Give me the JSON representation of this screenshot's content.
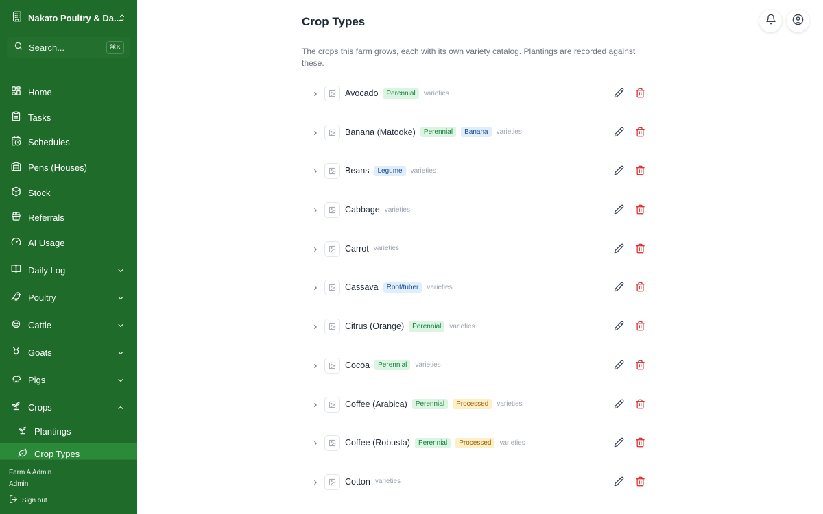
{
  "farm": {
    "name": "Nakato Poultry & Da..."
  },
  "search": {
    "placeholder": "Search...",
    "shortcut": "⌘K"
  },
  "nav": [
    {
      "label": "Home",
      "icon": "grid-icon"
    },
    {
      "label": "Tasks",
      "icon": "clipboard-icon"
    },
    {
      "label": "Schedules",
      "icon": "calendar-clock-icon"
    },
    {
      "label": "Pens (Houses)",
      "icon": "warehouse-icon"
    },
    {
      "label": "Stock",
      "icon": "box-icon"
    },
    {
      "label": "Referrals",
      "icon": "gift-icon"
    },
    {
      "label": "AI Usage",
      "icon": "gauge-icon"
    },
    {
      "label": "Daily Log",
      "icon": "book-icon",
      "expanded": false
    },
    {
      "label": "Poultry",
      "icon": "bird-icon",
      "expanded": false
    },
    {
      "label": "Cattle",
      "icon": "cow-icon",
      "expanded": false
    },
    {
      "label": "Goats",
      "icon": "goat-icon",
      "expanded": false
    },
    {
      "label": "Pigs",
      "icon": "pig-icon",
      "expanded": false
    },
    {
      "label": "Crops",
      "icon": "sprout-icon",
      "expanded": true
    }
  ],
  "subnav": [
    {
      "label": "Plantings",
      "icon": "sprout-icon"
    },
    {
      "label": "Crop Types",
      "icon": "leaf-icon",
      "active": true
    }
  ],
  "user": {
    "name": "Farm A Admin",
    "role": "Admin",
    "signout": "Sign out"
  },
  "page": {
    "title": "Crop Types",
    "description": "The crops this farm grows, each with its own variety catalog. Plantings are recorded against these."
  },
  "varieties_label": "varieties",
  "crops": [
    {
      "name": "Avocado",
      "tags": [
        {
          "text": "Perennial",
          "color": "green"
        }
      ]
    },
    {
      "name": "Banana (Matooke)",
      "tags": [
        {
          "text": "Perennial",
          "color": "green"
        },
        {
          "text": "Banana",
          "color": "blue"
        }
      ]
    },
    {
      "name": "Beans",
      "tags": [
        {
          "text": "Legume",
          "color": "blue"
        }
      ]
    },
    {
      "name": "Cabbage",
      "tags": []
    },
    {
      "name": "Carrot",
      "tags": []
    },
    {
      "name": "Cassava",
      "tags": [
        {
          "text": "Root/tuber",
          "color": "blue"
        }
      ]
    },
    {
      "name": "Citrus (Orange)",
      "tags": [
        {
          "text": "Perennial",
          "color": "green"
        }
      ]
    },
    {
      "name": "Cocoa",
      "tags": [
        {
          "text": "Perennial",
          "color": "green"
        }
      ]
    },
    {
      "name": "Coffee (Arabica)",
      "tags": [
        {
          "text": "Perennial",
          "color": "green"
        },
        {
          "text": "Processed",
          "color": "yellow"
        }
      ]
    },
    {
      "name": "Coffee (Robusta)",
      "tags": [
        {
          "text": "Perennial",
          "color": "green"
        },
        {
          "text": "Processed",
          "color": "yellow"
        }
      ]
    },
    {
      "name": "Cotton",
      "tags": []
    }
  ],
  "colors": {
    "sidebar": "#1e6b2a",
    "active": "#2a8a38",
    "delete": "#dc2626"
  }
}
